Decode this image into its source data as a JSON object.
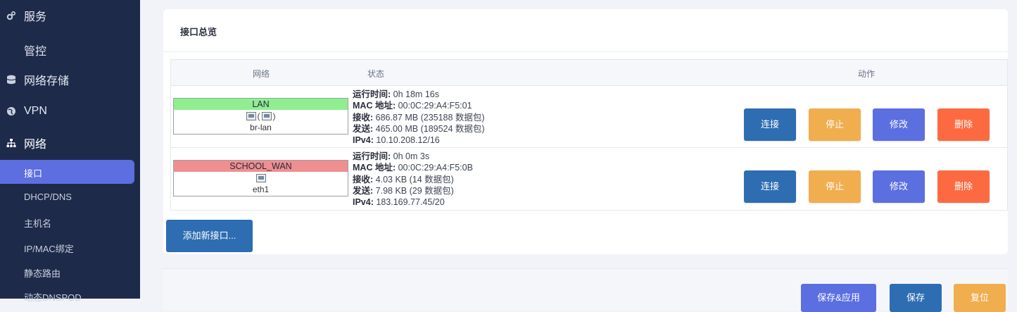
{
  "sidebar": {
    "menu": [
      {
        "label": "服务",
        "icon": "gears-icon"
      },
      {
        "label": "网络存储",
        "icon": "database-icon"
      },
      {
        "label": "VPN",
        "icon": "globe-icon"
      },
      {
        "label": "网络",
        "icon": "sitemap-icon"
      }
    ],
    "sub_items": [
      "管控",
      "接口",
      "DHCP/DNS",
      "主机名",
      "IP/MAC绑定",
      "静态路由",
      "动态DNSPOD"
    ],
    "active_sub": "接口"
  },
  "card": {
    "title": "接口总览",
    "headers": {
      "network": "网络",
      "status": "状态",
      "actions": "动作"
    },
    "interfaces": [
      {
        "name": "LAN",
        "color": "#90ee90",
        "icon_text_open": "(",
        "icon_text_close": ")",
        "device": "br-lan",
        "uptime_label": "运行时间:",
        "uptime": "0h 18m 16s",
        "mac_label": "MAC 地址:",
        "mac": "00:0C:29:A4:F5:01",
        "rx_label": "接收:",
        "rx": "686.87 MB (235188 数据包)",
        "tx_label": "发送:",
        "tx": "465.00 MB (189524 数据包)",
        "ipv4_label": "IPv4:",
        "ipv4": "10.10.208.12/16"
      },
      {
        "name": "SCHOOL_WAN",
        "color": "#f08f8f",
        "device": "eth1",
        "uptime_label": "运行时间:",
        "uptime": "0h 0m 3s",
        "mac_label": "MAC 地址:",
        "mac": "00:0C:29:A4:F5:0B",
        "rx_label": "接收:",
        "rx": "4.03 KB (14 数据包)",
        "tx_label": "发送:",
        "tx": "7.98 KB (29 数据包)",
        "ipv4_label": "IPv4:",
        "ipv4": "183.169.77.45/20"
      }
    ],
    "buttons": {
      "connect": "连接",
      "stop": "停止",
      "edit": "修改",
      "delete": "删除"
    },
    "add_button": "添加新接口..."
  },
  "footer": {
    "save_apply": "保存&应用",
    "save": "保存",
    "reset": "复位"
  },
  "colors": {
    "sidebar_bg": "#1e2a4a",
    "accent": "#5c6ee0",
    "connect": "#2e6db2",
    "stop": "#f0ae4e",
    "edit": "#5b6fe1",
    "delete": "#fd6a41"
  }
}
